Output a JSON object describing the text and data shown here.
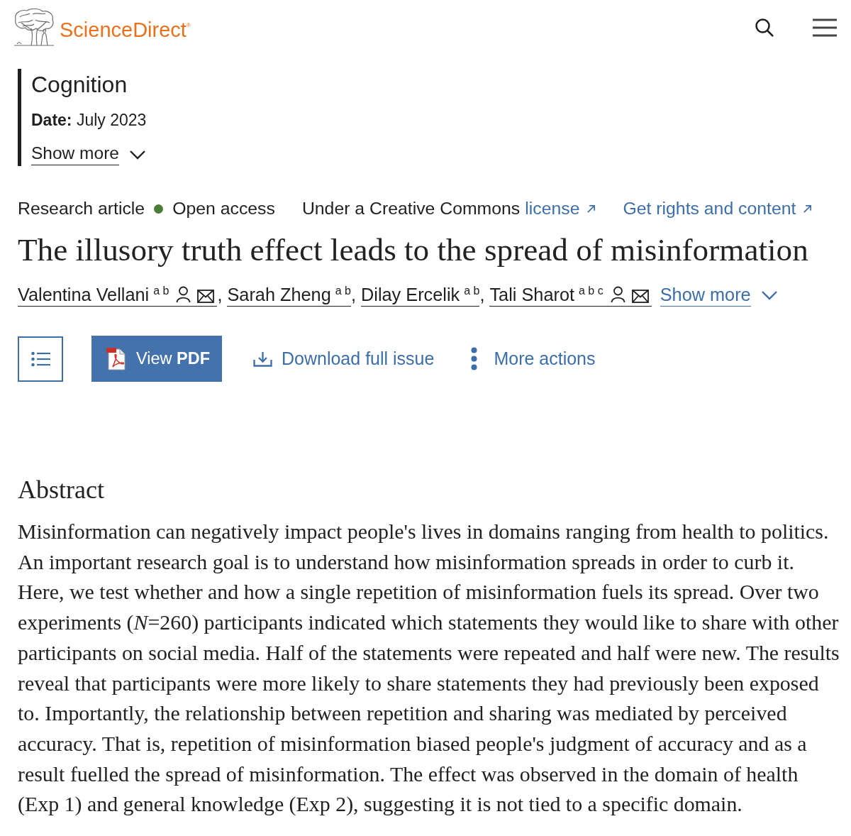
{
  "header": {
    "logo": "ScienceDirect$^{®}$"
  },
  "journal": {
    "name": "Cognition",
    "date_label": "Date:",
    "date": "July 2023",
    "show_more": "Show more"
  },
  "meta": {
    "article_type": "Research article",
    "access": "Open access",
    "license_text": "Under a Creative Commons",
    "license_link": "license",
    "rights_link": "Get rights and content"
  },
  "title": "The illusory truth effect leads to the spread of misinformation",
  "authors": [
    {
      "name": "Valentina Vellani",
      "affiliations": "a b",
      "profile": true,
      "email": true,
      "separator": ","
    },
    {
      "name": "Sarah Zheng",
      "affiliations": "a b",
      "profile": false,
      "email": false,
      "separator": ","
    },
    {
      "name": "Dilay Ercelik",
      "affiliations": "a b",
      "profile": false,
      "email": false,
      "separator": ","
    },
    {
      "name": "Tali Sharot",
      "affiliations": "a b c",
      "profile": true,
      "email": true
    }
  ],
  "authors_show_more": "Show more",
  "toolbar": [
    {
      "kind": "outline"
    },
    {
      "kind": "pdf",
      "label": "View **PDF**"
    },
    {
      "kind": "download",
      "label": "Download full issue"
    },
    {
      "kind": "more",
      "label": "More actions"
    }
  ],
  "abstract": {
    "heading": "Abstract",
    "text": "Misinformation can negatively impact people's lives in domains ranging from health to politics. An important research goal is to understand how misinformation spreads in order to curb it. Here, we test whether and how a single repetition of misinformation fuels its spread. Over two experiments (*N*=260) participants indicated which statements they would like to share with other participants on social media. Half of the statements were repeated and half were new. The results reveal that participants were more likely to share statements they had previously been exposed to. Importantly, the relationship between repetition and sharing was mediated by perceived accuracy. That is, repetition of misinformation biased people's judgment of accuracy and as a result fuelled the spread of misinformation. The effect was observed in the domain of health (Exp 1) and general knowledge (Exp 2), suggesting it is not tied to a specific domain."
  }
}
